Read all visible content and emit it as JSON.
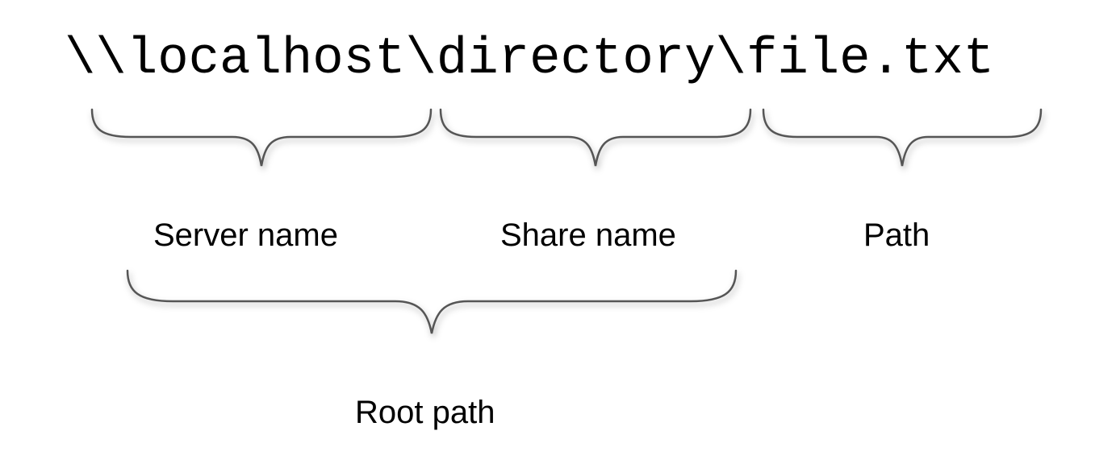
{
  "path": {
    "full": "\\\\localhost\\directory\\file.txt",
    "server_segment": "\\\\localhost",
    "share_segment": "\\directory",
    "file_segment": "\\file.txt"
  },
  "labels": {
    "server": "Server name",
    "share": "Share name",
    "path": "Path",
    "root": "Root path"
  }
}
